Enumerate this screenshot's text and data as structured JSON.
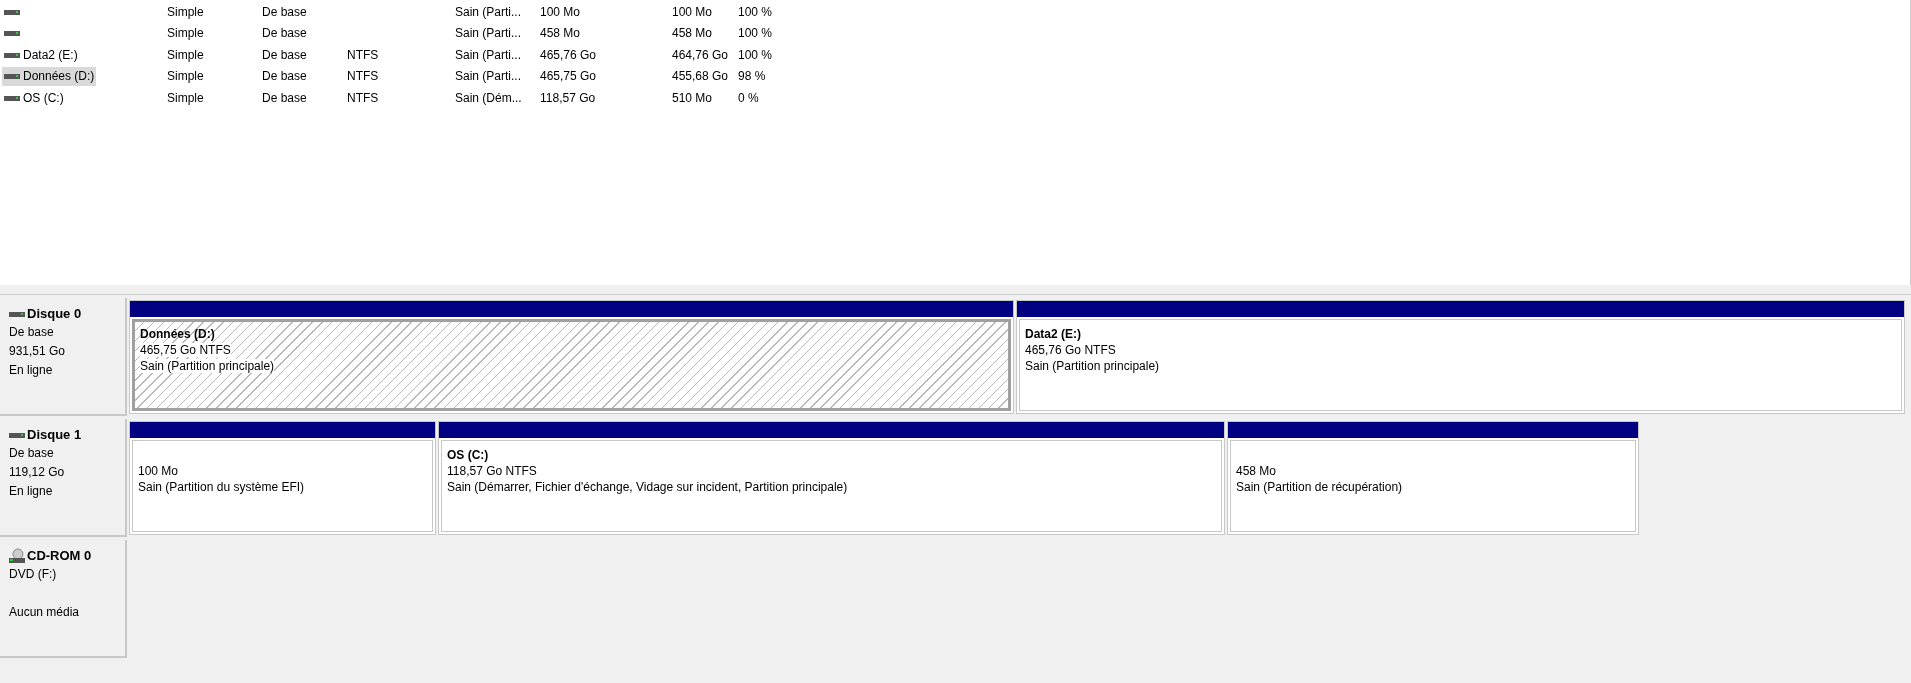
{
  "volumes": [
    {
      "layout": "Simple",
      "type": "De base",
      "status": "Sain (Parti...",
      "capacity": "100 Mo",
      "free": "100 Mo",
      "pct": "100 %",
      "selected": false
    },
    {
      "layout": "Simple",
      "type": "De base",
      "status": "Sain (Parti...",
      "capacity": "458 Mo",
      "free": "458 Mo",
      "pct": "100 %",
      "selected": false
    },
    {
      "name": "Data2 (E:)",
      "layout": "Simple",
      "type": "De base",
      "fs": "NTFS",
      "status": "Sain (Parti...",
      "capacity": "465,76 Go",
      "free": "464,76 Go",
      "pct": "100 %",
      "selected": false
    },
    {
      "name": "Données (D:)",
      "layout": "Simple",
      "type": "De base",
      "fs": "NTFS",
      "status": "Sain (Parti...",
      "capacity": "465,75 Go",
      "free": "455,68 Go",
      "pct": "98 %",
      "selected": true
    },
    {
      "name": "OS (C:)",
      "layout": "Simple",
      "type": "De base",
      "fs": "NTFS",
      "status": "Sain (Dém...",
      "capacity": "118,57 Go",
      "free": "510 Mo",
      "pct": "0 %",
      "selected": false
    }
  ],
  "disks": [
    {
      "kind": "disk",
      "title": "Disque 0",
      "lines": [
        "De base",
        "931,51 Go",
        "En ligne"
      ],
      "partitions": [
        {
          "title": "Données  (D:)",
          "size": "465,75 Go NTFS",
          "status": "Sain (Partition principale)",
          "selected": true
        },
        {
          "title": "Data2  (E:)",
          "size": "465,76 Go NTFS",
          "status": "Sain (Partition principale)",
          "selected": false
        }
      ]
    },
    {
      "kind": "disk",
      "title": "Disque 1",
      "lines": [
        "De base",
        "119,12 Go",
        "En ligne"
      ],
      "partitions": [
        {
          "size": "100 Mo",
          "status": "Sain (Partition du système EFI)",
          "selected": false
        },
        {
          "title": "OS  (C:)",
          "size": "118,57 Go NTFS",
          "status": "Sain (Démarrer, Fichier d'échange, Vidage sur incident, Partition principale)",
          "selected": false
        },
        {
          "size": "458 Mo",
          "status": "Sain (Partition de récupération)",
          "selected": false
        }
      ]
    },
    {
      "kind": "cdrom",
      "title": "CD-ROM 0",
      "lines": [
        "DVD (F:)",
        "Aucun média"
      ]
    }
  ]
}
